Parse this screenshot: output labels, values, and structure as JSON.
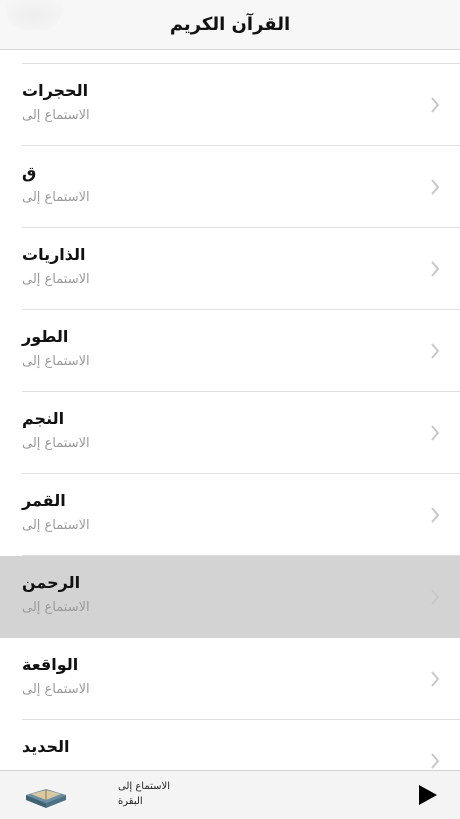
{
  "navbar": {
    "title": "القرآن الكريم"
  },
  "list": {
    "rows": [
      {
        "name": "الحجرات",
        "subtitle": "الاستماع إلى",
        "selected": false
      },
      {
        "name": "ق",
        "subtitle": "الاستماع إلى",
        "selected": false
      },
      {
        "name": "الذاريات",
        "subtitle": "الاستماع إلى",
        "selected": false
      },
      {
        "name": "الطور",
        "subtitle": "الاستماع إلى",
        "selected": false
      },
      {
        "name": "النجم",
        "subtitle": "الاستماع إلى",
        "selected": false
      },
      {
        "name": "القمر",
        "subtitle": "الاستماع إلى",
        "selected": false
      },
      {
        "name": "الرحمن",
        "subtitle": "الاستماع إلى",
        "selected": true
      },
      {
        "name": "الواقعة",
        "subtitle": "الاستماع إلى",
        "selected": false
      },
      {
        "name": "الحديد",
        "subtitle": "",
        "selected": false
      }
    ]
  },
  "player": {
    "label": "الاستماع إلى",
    "current_sura": "البقرة",
    "play_icon": "play-icon",
    "cover_icon": "quran-book-icon"
  },
  "colors": {
    "selected_row": "#d3d3d3",
    "subtitle": "#9a9a9a",
    "chevron": "#c7c7cc"
  }
}
